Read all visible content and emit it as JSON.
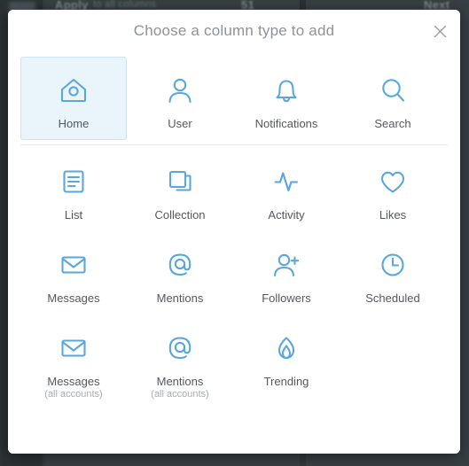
{
  "backdrop": {
    "app_label": "Apply",
    "app_sublabel": "to all columns",
    "count_label": "51",
    "right_label": "Next"
  },
  "modal": {
    "title": "Choose a column type to add",
    "close_icon": "close-icon",
    "accent_color": "#5aa7dd",
    "selected_tile_bg": "#e9f4fb",
    "selected_tile_border": "#cfe3f0",
    "label_color": "#55595c",
    "sublabel_color": "#a7adb2",
    "title_color": "#8b949a"
  },
  "rows": [
    {
      "tiles": [
        {
          "id": "home",
          "label": "Home",
          "sublabel": "",
          "icon": "home-icon",
          "selected": true
        },
        {
          "id": "user",
          "label": "User",
          "sublabel": "",
          "icon": "user-icon",
          "selected": false
        },
        {
          "id": "notifications",
          "label": "Notifications",
          "sublabel": "",
          "icon": "bell-icon",
          "selected": false
        },
        {
          "id": "search",
          "label": "Search",
          "sublabel": "",
          "icon": "search-icon",
          "selected": false
        }
      ]
    },
    {
      "tiles": [
        {
          "id": "list",
          "label": "List",
          "sublabel": "",
          "icon": "list-icon",
          "selected": false
        },
        {
          "id": "collection",
          "label": "Collection",
          "sublabel": "",
          "icon": "collection-icon",
          "selected": false
        },
        {
          "id": "activity",
          "label": "Activity",
          "sublabel": "",
          "icon": "activity-icon",
          "selected": false
        },
        {
          "id": "likes",
          "label": "Likes",
          "sublabel": "",
          "icon": "heart-icon",
          "selected": false
        }
      ]
    },
    {
      "tiles": [
        {
          "id": "messages",
          "label": "Messages",
          "sublabel": "",
          "icon": "envelope-icon",
          "selected": false
        },
        {
          "id": "mentions",
          "label": "Mentions",
          "sublabel": "",
          "icon": "at-icon",
          "selected": false
        },
        {
          "id": "followers",
          "label": "Followers",
          "sublabel": "",
          "icon": "user-plus-icon",
          "selected": false
        },
        {
          "id": "scheduled",
          "label": "Scheduled",
          "sublabel": "",
          "icon": "clock-icon",
          "selected": false
        }
      ]
    },
    {
      "tiles": [
        {
          "id": "messages-all-accounts",
          "label": "Messages",
          "sublabel": "(all accounts)",
          "icon": "envelope-icon",
          "selected": false
        },
        {
          "id": "mentions-all-accounts",
          "label": "Mentions",
          "sublabel": "(all accounts)",
          "icon": "at-icon",
          "selected": false
        },
        {
          "id": "trending",
          "label": "Trending",
          "sublabel": "",
          "icon": "flame-icon",
          "selected": false
        }
      ]
    }
  ]
}
